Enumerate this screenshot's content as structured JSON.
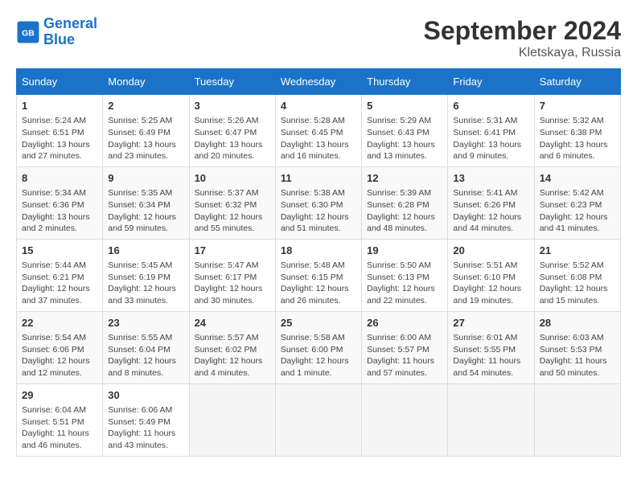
{
  "header": {
    "logo_line1": "General",
    "logo_line2": "Blue",
    "month": "September 2024",
    "location": "Kletskaya, Russia"
  },
  "days_of_week": [
    "Sunday",
    "Monday",
    "Tuesday",
    "Wednesday",
    "Thursday",
    "Friday",
    "Saturday"
  ],
  "weeks": [
    [
      {
        "day": "1",
        "info": "Sunrise: 5:24 AM\nSunset: 6:51 PM\nDaylight: 13 hours\nand 27 minutes."
      },
      {
        "day": "2",
        "info": "Sunrise: 5:25 AM\nSunset: 6:49 PM\nDaylight: 13 hours\nand 23 minutes."
      },
      {
        "day": "3",
        "info": "Sunrise: 5:26 AM\nSunset: 6:47 PM\nDaylight: 13 hours\nand 20 minutes."
      },
      {
        "day": "4",
        "info": "Sunrise: 5:28 AM\nSunset: 6:45 PM\nDaylight: 13 hours\nand 16 minutes."
      },
      {
        "day": "5",
        "info": "Sunrise: 5:29 AM\nSunset: 6:43 PM\nDaylight: 13 hours\nand 13 minutes."
      },
      {
        "day": "6",
        "info": "Sunrise: 5:31 AM\nSunset: 6:41 PM\nDaylight: 13 hours\nand 9 minutes."
      },
      {
        "day": "7",
        "info": "Sunrise: 5:32 AM\nSunset: 6:38 PM\nDaylight: 13 hours\nand 6 minutes."
      }
    ],
    [
      {
        "day": "8",
        "info": "Sunrise: 5:34 AM\nSunset: 6:36 PM\nDaylight: 13 hours\nand 2 minutes."
      },
      {
        "day": "9",
        "info": "Sunrise: 5:35 AM\nSunset: 6:34 PM\nDaylight: 12 hours\nand 59 minutes."
      },
      {
        "day": "10",
        "info": "Sunrise: 5:37 AM\nSunset: 6:32 PM\nDaylight: 12 hours\nand 55 minutes."
      },
      {
        "day": "11",
        "info": "Sunrise: 5:38 AM\nSunset: 6:30 PM\nDaylight: 12 hours\nand 51 minutes."
      },
      {
        "day": "12",
        "info": "Sunrise: 5:39 AM\nSunset: 6:28 PM\nDaylight: 12 hours\nand 48 minutes."
      },
      {
        "day": "13",
        "info": "Sunrise: 5:41 AM\nSunset: 6:26 PM\nDaylight: 12 hours\nand 44 minutes."
      },
      {
        "day": "14",
        "info": "Sunrise: 5:42 AM\nSunset: 6:23 PM\nDaylight: 12 hours\nand 41 minutes."
      }
    ],
    [
      {
        "day": "15",
        "info": "Sunrise: 5:44 AM\nSunset: 6:21 PM\nDaylight: 12 hours\nand 37 minutes."
      },
      {
        "day": "16",
        "info": "Sunrise: 5:45 AM\nSunset: 6:19 PM\nDaylight: 12 hours\nand 33 minutes."
      },
      {
        "day": "17",
        "info": "Sunrise: 5:47 AM\nSunset: 6:17 PM\nDaylight: 12 hours\nand 30 minutes."
      },
      {
        "day": "18",
        "info": "Sunrise: 5:48 AM\nSunset: 6:15 PM\nDaylight: 12 hours\nand 26 minutes."
      },
      {
        "day": "19",
        "info": "Sunrise: 5:50 AM\nSunset: 6:13 PM\nDaylight: 12 hours\nand 22 minutes."
      },
      {
        "day": "20",
        "info": "Sunrise: 5:51 AM\nSunset: 6:10 PM\nDaylight: 12 hours\nand 19 minutes."
      },
      {
        "day": "21",
        "info": "Sunrise: 5:52 AM\nSunset: 6:08 PM\nDaylight: 12 hours\nand 15 minutes."
      }
    ],
    [
      {
        "day": "22",
        "info": "Sunrise: 5:54 AM\nSunset: 6:06 PM\nDaylight: 12 hours\nand 12 minutes."
      },
      {
        "day": "23",
        "info": "Sunrise: 5:55 AM\nSunset: 6:04 PM\nDaylight: 12 hours\nand 8 minutes."
      },
      {
        "day": "24",
        "info": "Sunrise: 5:57 AM\nSunset: 6:02 PM\nDaylight: 12 hours\nand 4 minutes."
      },
      {
        "day": "25",
        "info": "Sunrise: 5:58 AM\nSunset: 6:00 PM\nDaylight: 12 hours\nand 1 minute."
      },
      {
        "day": "26",
        "info": "Sunrise: 6:00 AM\nSunset: 5:57 PM\nDaylight: 11 hours\nand 57 minutes."
      },
      {
        "day": "27",
        "info": "Sunrise: 6:01 AM\nSunset: 5:55 PM\nDaylight: 11 hours\nand 54 minutes."
      },
      {
        "day": "28",
        "info": "Sunrise: 6:03 AM\nSunset: 5:53 PM\nDaylight: 11 hours\nand 50 minutes."
      }
    ],
    [
      {
        "day": "29",
        "info": "Sunrise: 6:04 AM\nSunset: 5:51 PM\nDaylight: 11 hours\nand 46 minutes."
      },
      {
        "day": "30",
        "info": "Sunrise: 6:06 AM\nSunset: 5:49 PM\nDaylight: 11 hours\nand 43 minutes."
      },
      {
        "day": "",
        "info": ""
      },
      {
        "day": "",
        "info": ""
      },
      {
        "day": "",
        "info": ""
      },
      {
        "day": "",
        "info": ""
      },
      {
        "day": "",
        "info": ""
      }
    ]
  ]
}
